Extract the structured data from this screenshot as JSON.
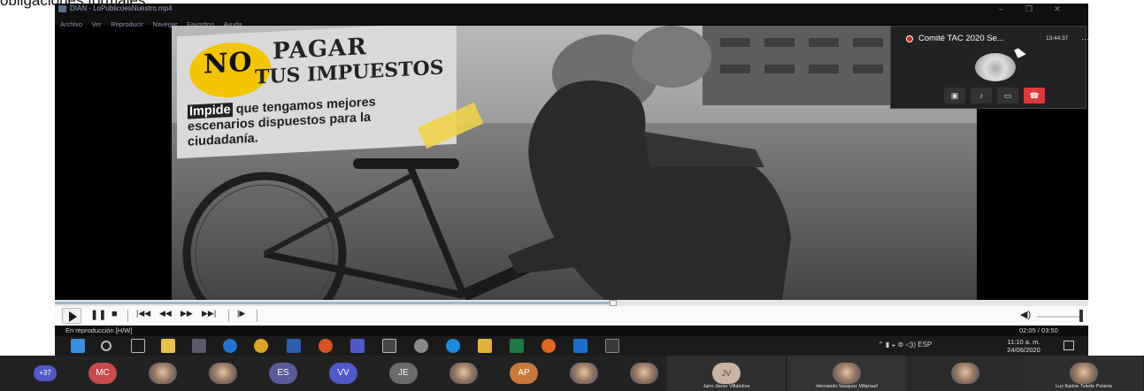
{
  "caption": "obligaciones formales.",
  "player": {
    "window_title": "DIAN - LoPublicoesNuestro.mp4",
    "window_buttons": [
      "–",
      "❐",
      "✕"
    ],
    "menu": [
      "Archivo",
      "Ver",
      "Reproducir",
      "Navegar",
      "Favoritos",
      "Ayuda"
    ],
    "status": "En reproducción [H/W]",
    "time": "02:05 / 03:50",
    "position_fraction": 0.54
  },
  "video_sign": {
    "no": "NO",
    "pagar": "PAGAR",
    "impuestos": "TUS IMPUESTOS",
    "highlight": "Impide",
    "body": " que tengamos mejores escenarios dispuestos para la ciudadanía."
  },
  "meeting": {
    "title": "Comité TAC 2020 Se...",
    "time": "13:44:37",
    "more": "…"
  },
  "taskbar": {
    "tray": "⌃ ▮ ◒ ⊚ ◁)) ESP",
    "clock_time": "11:10 a. m.",
    "clock_date": "24/06/2020"
  },
  "participants": {
    "overflow": "+37",
    "avatars": [
      {
        "initials": "MC",
        "color": "#c94a4a"
      },
      {
        "initials": "",
        "color": ""
      },
      {
        "initials": "",
        "color": ""
      },
      {
        "initials": "ES",
        "color": "#5a5a9c"
      },
      {
        "initials": "VV",
        "color": "#5059c9"
      },
      {
        "initials": "JE",
        "color": "#6b6b6b"
      },
      {
        "initials": "",
        "color": ""
      },
      {
        "initials": "AP",
        "color": "#c9783a"
      },
      {
        "initials": "",
        "color": ""
      },
      {
        "initials": "",
        "color": ""
      }
    ],
    "tiles": [
      {
        "initials": "JV",
        "name": "Jairo Javier Villalobos"
      },
      {
        "initials": "",
        "name": "Hernando Vasquez Villarruel"
      },
      {
        "initials": "",
        "name": ""
      },
      {
        "initials": "",
        "name": ""
      },
      {
        "initials": "",
        "name": "Luz Karine Toledo Polania"
      }
    ]
  }
}
